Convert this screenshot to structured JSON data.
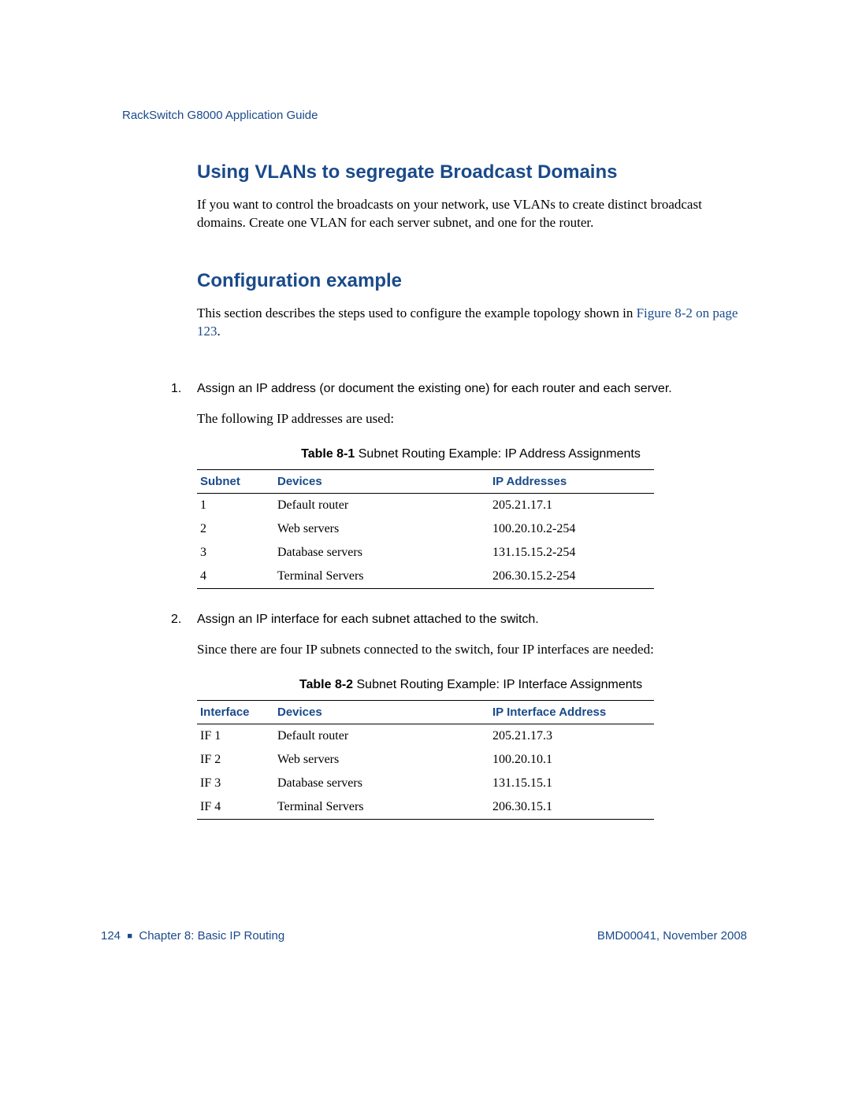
{
  "header": {
    "title": "RackSwitch G8000  Application Guide"
  },
  "section1": {
    "heading": "Using VLANs to segregate Broadcast Domains",
    "para1": "If you want to control the broadcasts on your network, use VLANs to create distinct broadcast domains. Create one VLAN for each server subnet, and one for the router."
  },
  "section2": {
    "heading": "Configuration example",
    "para_lead": "This section describes the steps used to configure the example topology shown in ",
    "para_link": "Figure 8-2 on page 123",
    "para_tail": "."
  },
  "steps": {
    "s1": {
      "num": "1.",
      "text": "Assign an IP address (or document the existing one) for each router and each server.",
      "sub": "The following IP addresses are used:"
    },
    "s2": {
      "num": "2.",
      "text": "Assign an IP interface for each subnet attached to the switch.",
      "sub": "Since there are four IP subnets connected to the switch, four IP interfaces are needed:"
    }
  },
  "table1": {
    "caption_bold": "Table 8-1",
    "caption_rest": "  Subnet Routing Example: IP Address Assignments",
    "headers": {
      "c1": "Subnet",
      "c2": "Devices",
      "c3": "IP Addresses"
    },
    "rows": [
      {
        "c1": "1",
        "c2": "Default router",
        "c3": "205.21.17.1"
      },
      {
        "c1": "2",
        "c2": "Web servers",
        "c3": "100.20.10.2-254"
      },
      {
        "c1": "3",
        "c2": "Database servers",
        "c3": "131.15.15.2-254"
      },
      {
        "c1": "4",
        "c2": "Terminal Servers",
        "c3": "206.30.15.2-254"
      }
    ]
  },
  "table2": {
    "caption_bold": "Table 8-2",
    "caption_rest": "  Subnet Routing Example: IP Interface Assignments",
    "headers": {
      "c1": "Interface",
      "c2": "Devices",
      "c3": "IP Interface Address"
    },
    "rows": [
      {
        "c1": "IF 1",
        "c2": "Default router",
        "c3": "205.21.17.3"
      },
      {
        "c1": "IF 2",
        "c2": "Web servers",
        "c3": "100.20.10.1"
      },
      {
        "c1": "IF 3",
        "c2": "Database servers",
        "c3": "131.15.15.1"
      },
      {
        "c1": "IF 4",
        "c2": "Terminal Servers",
        "c3": "206.30.15.1"
      }
    ]
  },
  "footer": {
    "page": "124",
    "chapter": "Chapter 8:  Basic IP Routing",
    "docid": "BMD00041, November 2008"
  }
}
